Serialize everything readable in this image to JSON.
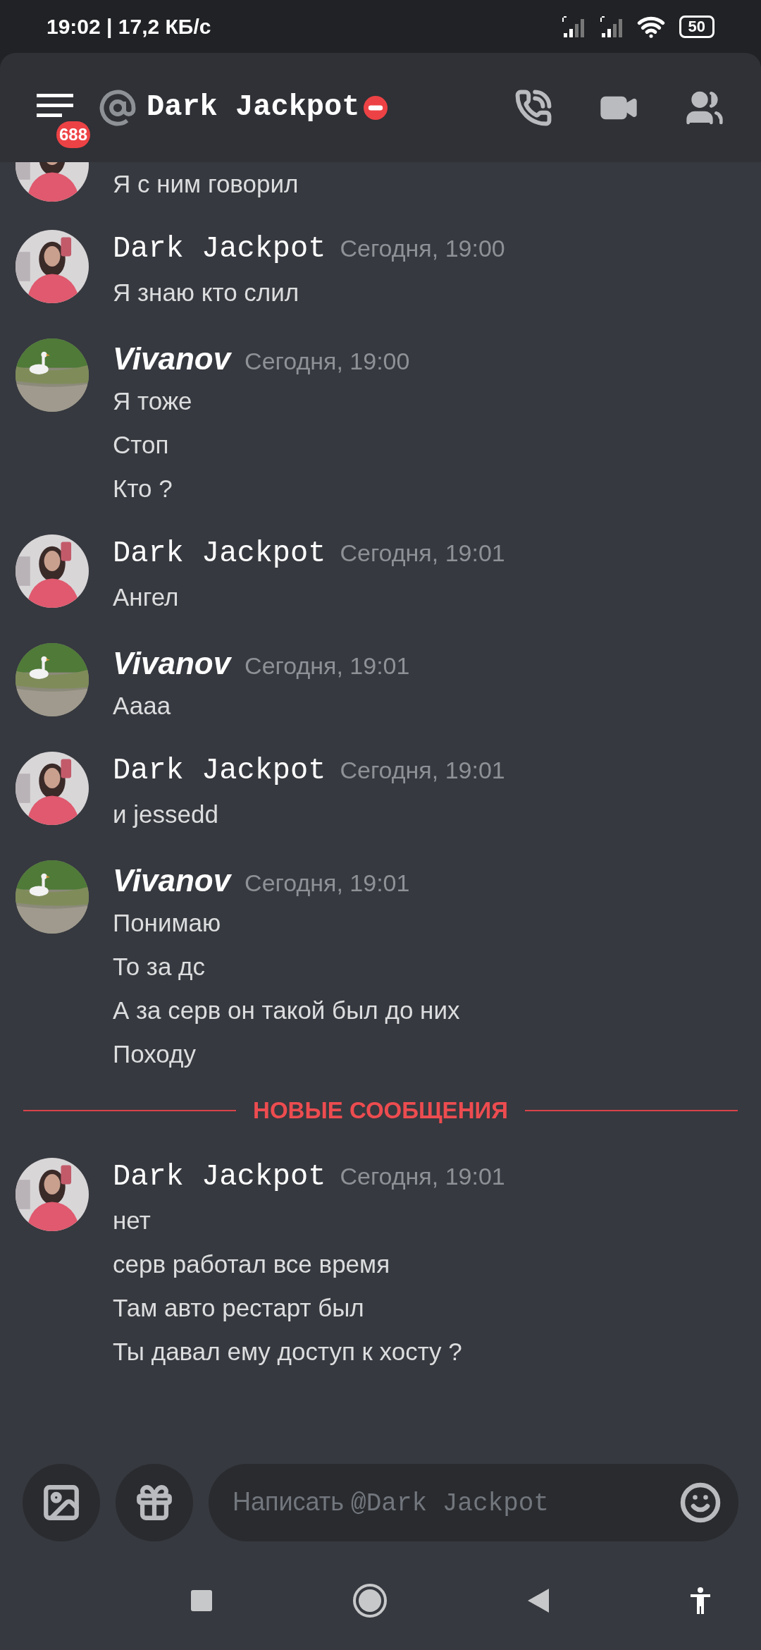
{
  "status_bar": {
    "time": "19:02 | 17,2 КБ/с",
    "battery": "50"
  },
  "header": {
    "badge": "688",
    "title": "Dark Jackpot",
    "dnd": true
  },
  "messages": [
    {
      "kind": "girl",
      "lines": [
        "Я с ним говорил"
      ]
    },
    {
      "kind": "girl",
      "author": "Dark Jackpot",
      "time": "Сегодня, 19:00",
      "lines": [
        "Я знаю кто слил"
      ]
    },
    {
      "kind": "goose",
      "author": "Vivanov",
      "time": "Сегодня, 19:00",
      "lines": [
        "Я тоже",
        "Стоп",
        "Кто ?"
      ]
    },
    {
      "kind": "girl",
      "author": "Dark Jackpot",
      "time": "Сегодня, 19:01",
      "lines": [
        "Ангел"
      ]
    },
    {
      "kind": "goose",
      "author": "Vivanov",
      "time": "Сегодня, 19:01",
      "lines": [
        "Аааа"
      ]
    },
    {
      "kind": "girl",
      "author": "Dark Jackpot",
      "time": "Сегодня, 19:01",
      "lines": [
        "и jessedd"
      ]
    },
    {
      "kind": "goose",
      "author": "Vivanov",
      "time": "Сегодня, 19:01",
      "lines": [
        "Понимаю",
        "То за дс",
        "А за серв он такой был до них",
        "Походу"
      ]
    },
    {
      "kind": "divider",
      "label": "НОВЫЕ СООБЩЕНИЯ"
    },
    {
      "kind": "girl",
      "author": "Dark Jackpot",
      "time": "Сегодня, 19:01",
      "lines": [
        "нет",
        "серв работал все время",
        "Там авто рестарт был",
        "Ты давал ему доступ к хосту ?"
      ]
    }
  ],
  "composer": {
    "placeholder_prefix": "Написать ",
    "placeholder_name": "@Dark Jackpot"
  }
}
